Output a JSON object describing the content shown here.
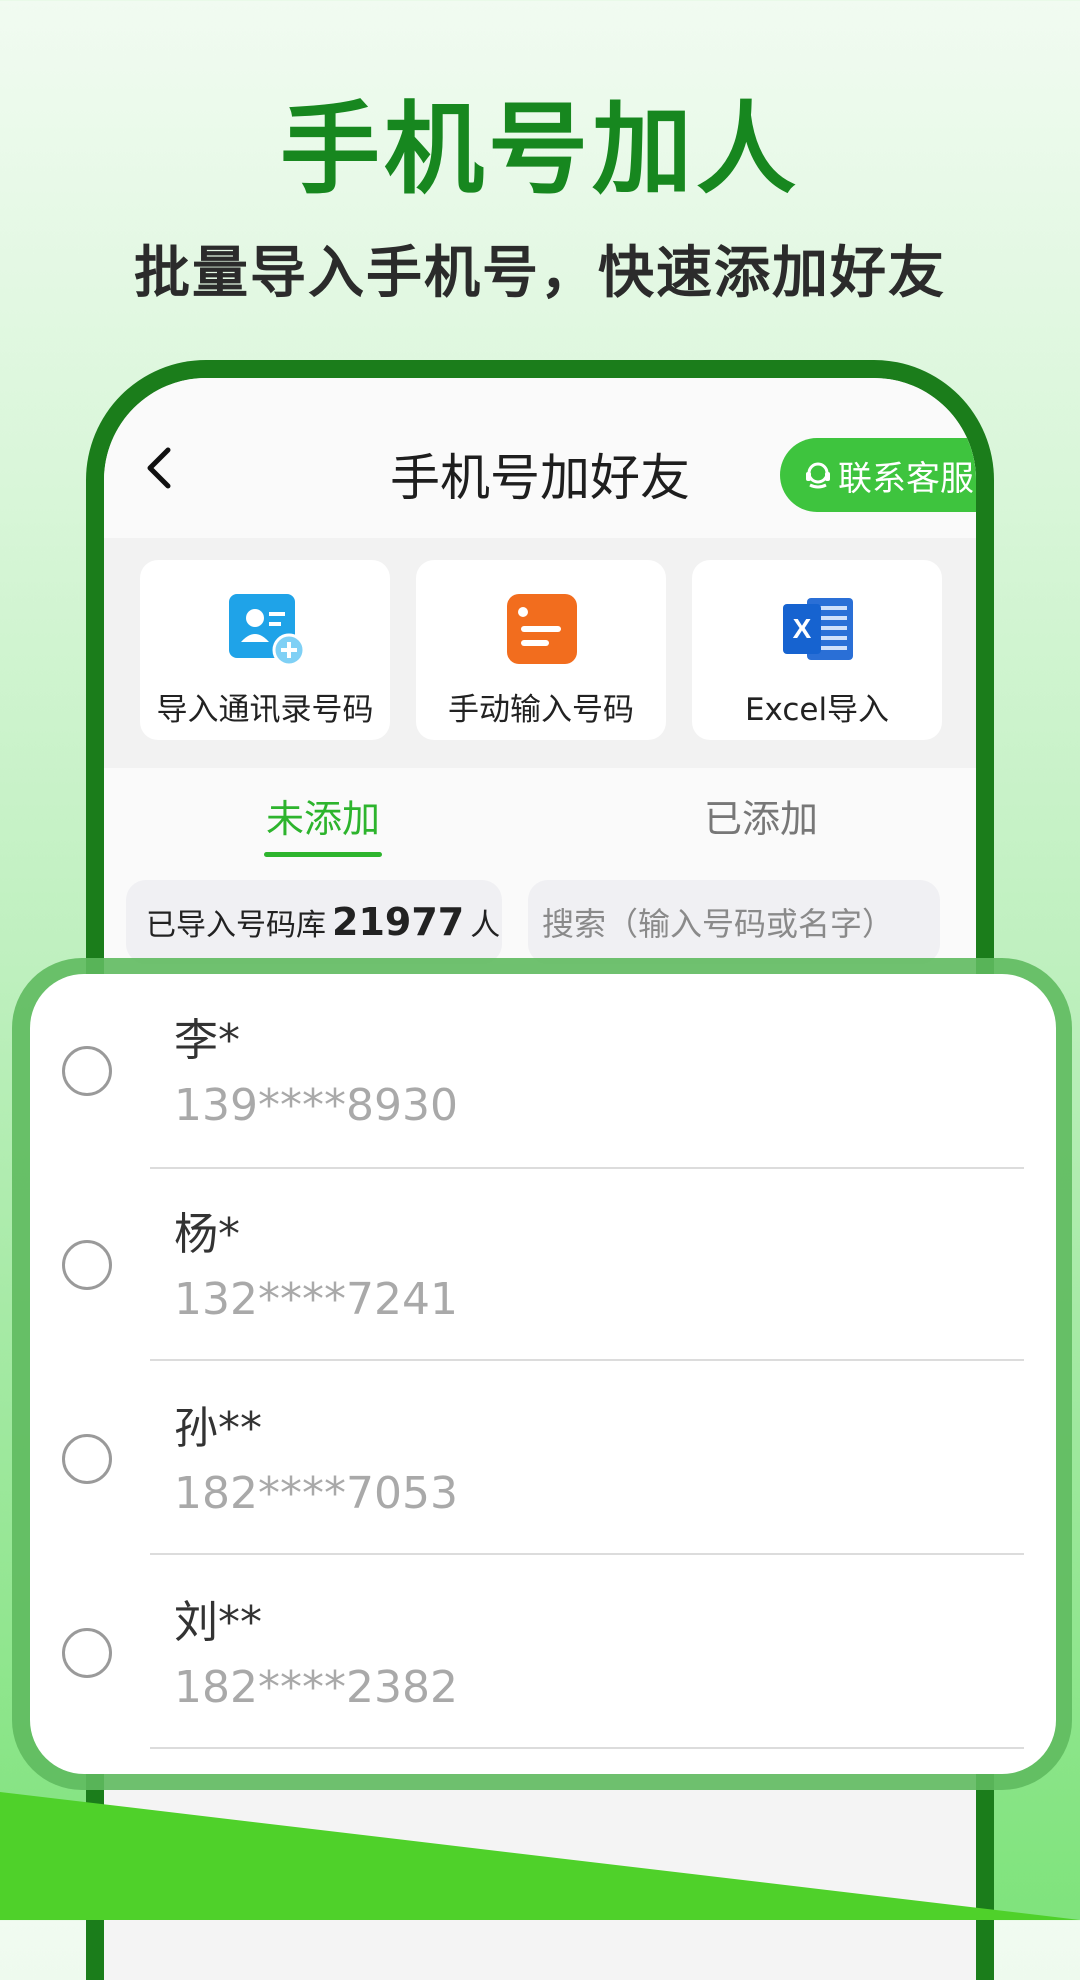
{
  "promo": {
    "headline": "手机号加人",
    "subline": "批量导入手机号，快速添加好友"
  },
  "header": {
    "title": "手机号加好友",
    "service_label": "联系客服"
  },
  "features": [
    {
      "label": "导入通讯录号码",
      "icon": "contacts-add-icon"
    },
    {
      "label": "手动输入号码",
      "icon": "manual-input-icon"
    },
    {
      "label": "Excel导入",
      "icon": "excel-icon"
    }
  ],
  "tabs": [
    {
      "label": "未添加",
      "active": true
    },
    {
      "label": "已添加",
      "active": false
    }
  ],
  "library": {
    "prefix": "已导入号码库",
    "count": "21977",
    "suffix": "人"
  },
  "search": {
    "placeholder": "搜索（输入号码或名字）"
  },
  "contacts": [
    {
      "name": "李*",
      "phone": "139****8930"
    },
    {
      "name": "杨*",
      "phone": "132****7241"
    },
    {
      "name": "孙**",
      "phone": "182****7053"
    },
    {
      "name": "刘**",
      "phone": "182****2382"
    }
  ],
  "colors": {
    "brand_green": "#1b7d1b",
    "accent_green": "#2db42d",
    "service_button": "#3ec43e"
  }
}
